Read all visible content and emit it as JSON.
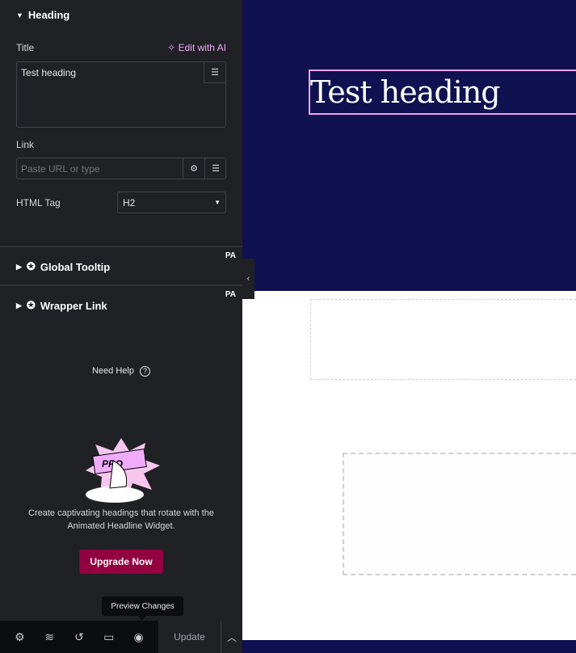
{
  "panel": {
    "section_title": "Heading",
    "title_label": "Title",
    "edit_ai": "Edit with AI",
    "title_value": "Test heading",
    "link_label": "Link",
    "link_placeholder": "Paste URL or type",
    "html_tag_label": "HTML Tag",
    "html_tag_value": "H2",
    "sections": [
      {
        "title": "Global Tooltip",
        "badge": "PA"
      },
      {
        "title": "Wrapper Link",
        "badge": "PA"
      }
    ],
    "need_help": "Need Help",
    "promo_badge": "PRO",
    "promo_text": "Create captivating headings that rotate with the Animated Headline Widget.",
    "upgrade": "Upgrade Now"
  },
  "footer": {
    "tooltip": "Preview Changes",
    "update": "Update"
  },
  "canvas": {
    "heading": "Test heading"
  },
  "colors": {
    "panel_bg": "#1f2124",
    "accent_ai": "#f0abfc",
    "upgrade": "#93003f",
    "canvas_bg": "#0f1150",
    "selection": "#f5a3f0"
  }
}
